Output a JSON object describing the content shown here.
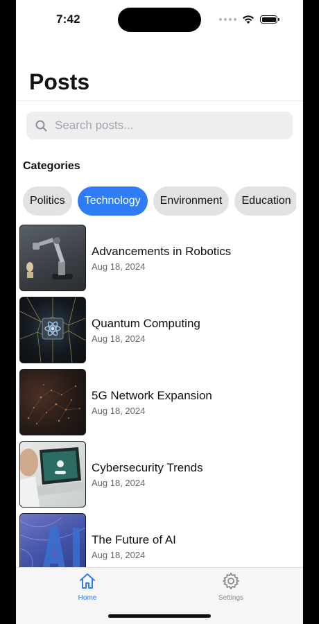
{
  "status_bar": {
    "time": "7:42"
  },
  "header": {
    "title": "Posts"
  },
  "search": {
    "placeholder": "Search posts...",
    "value": ""
  },
  "categories": {
    "label": "Categories",
    "items": [
      {
        "label": "Politics",
        "selected": false
      },
      {
        "label": "Technology",
        "selected": true
      },
      {
        "label": "Environment",
        "selected": false
      },
      {
        "label": "Education",
        "selected": false
      }
    ]
  },
  "posts": [
    {
      "title": "Advancements in Robotics",
      "date": "Aug 18, 2024",
      "image": "robot-arm-image"
    },
    {
      "title": "Quantum Computing",
      "date": "Aug 18, 2024",
      "image": "quantum-chip-image"
    },
    {
      "title": "5G Network Expansion",
      "date": "Aug 18, 2024",
      "image": "network-lights-image"
    },
    {
      "title": "Cybersecurity Trends",
      "date": "Aug 18, 2024",
      "image": "laptop-security-image"
    },
    {
      "title": "The Future of AI",
      "date": "Aug 18, 2024",
      "image": "ai-letters-image"
    }
  ],
  "tabbar": {
    "items": [
      {
        "label": "Home",
        "icon": "home-icon",
        "active": true
      },
      {
        "label": "Settings",
        "icon": "gear-icon",
        "active": false
      }
    ]
  },
  "colors": {
    "accent": "#2F7DF6",
    "chip_bg": "#E2E2E4",
    "search_bg": "#EEEEF0"
  }
}
